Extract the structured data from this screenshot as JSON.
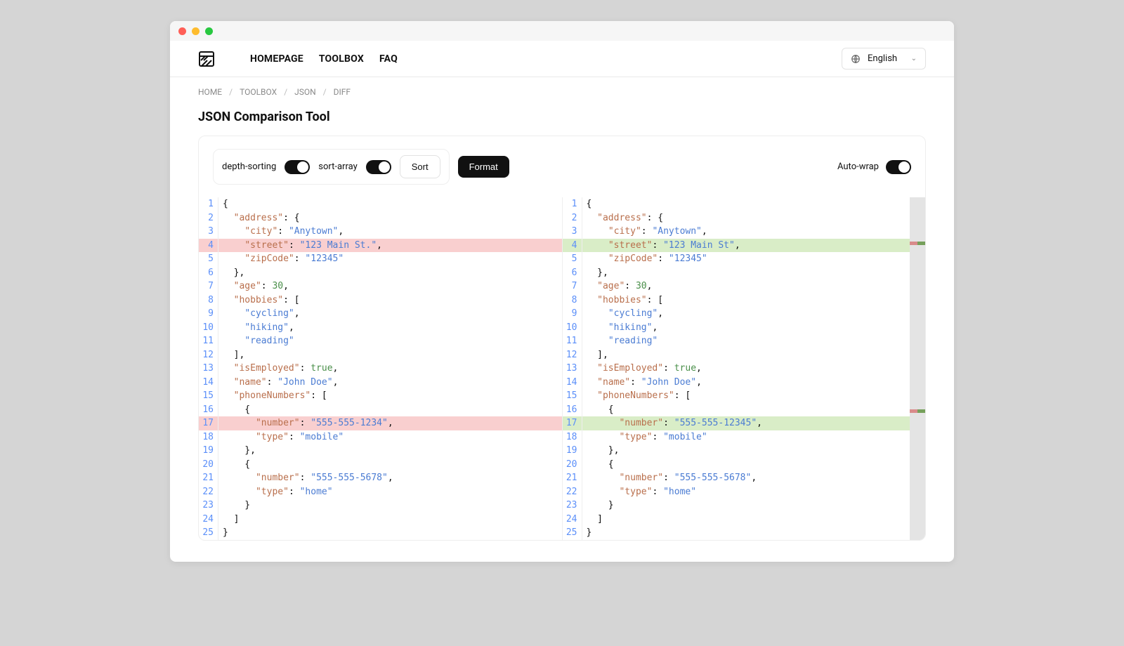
{
  "nav": {
    "home": "HOMEPAGE",
    "toolbox": "TOOLBOX",
    "faq": "FAQ"
  },
  "lang": {
    "label": "English"
  },
  "crumbs": {
    "home": "HOME",
    "toolbox": "TOOLBOX",
    "json": "JSON",
    "diff": "DIFF"
  },
  "title": "JSON Comparison Tool",
  "toolbar": {
    "depth": "depth-sorting",
    "sortarray": "sort-array",
    "sort": "Sort",
    "format": "Format",
    "autowrap": "Auto-wrap"
  },
  "leftLines": [
    [
      [
        "p",
        "{"
      ]
    ],
    [
      [
        "p",
        "  "
      ],
      [
        "k",
        "\"address\""
      ],
      [
        "p",
        ": {"
      ]
    ],
    [
      [
        "p",
        "    "
      ],
      [
        "k",
        "\"city\""
      ],
      [
        "p",
        ": "
      ],
      [
        "s",
        "\"Anytown\""
      ],
      [
        "p",
        ","
      ]
    ],
    [
      [
        "p",
        "    "
      ],
      [
        "k",
        "\"street\""
      ],
      [
        "p",
        ": "
      ],
      [
        "s",
        "\"123 Main St.\""
      ],
      [
        "p",
        ","
      ]
    ],
    [
      [
        "p",
        "    "
      ],
      [
        "k",
        "\"zipCode\""
      ],
      [
        "p",
        ": "
      ],
      [
        "s",
        "\"12345\""
      ]
    ],
    [
      [
        "p",
        "  },"
      ]
    ],
    [
      [
        "p",
        "  "
      ],
      [
        "k",
        "\"age\""
      ],
      [
        "p",
        ": "
      ],
      [
        "n",
        "30"
      ],
      [
        "p",
        ","
      ]
    ],
    [
      [
        "p",
        "  "
      ],
      [
        "k",
        "\"hobbies\""
      ],
      [
        "p",
        ": ["
      ]
    ],
    [
      [
        "p",
        "    "
      ],
      [
        "s",
        "\"cycling\""
      ],
      [
        "p",
        ","
      ]
    ],
    [
      [
        "p",
        "    "
      ],
      [
        "s",
        "\"hiking\""
      ],
      [
        "p",
        ","
      ]
    ],
    [
      [
        "p",
        "    "
      ],
      [
        "s",
        "\"reading\""
      ]
    ],
    [
      [
        "p",
        "  ],"
      ]
    ],
    [
      [
        "p",
        "  "
      ],
      [
        "k",
        "\"isEmployed\""
      ],
      [
        "p",
        ": "
      ],
      [
        "b",
        "true"
      ],
      [
        "p",
        ","
      ]
    ],
    [
      [
        "p",
        "  "
      ],
      [
        "k",
        "\"name\""
      ],
      [
        "p",
        ": "
      ],
      [
        "s",
        "\"John Doe\""
      ],
      [
        "p",
        ","
      ]
    ],
    [
      [
        "p",
        "  "
      ],
      [
        "k",
        "\"phoneNumbers\""
      ],
      [
        "p",
        ": ["
      ]
    ],
    [
      [
        "p",
        "    {"
      ]
    ],
    [
      [
        "p",
        "      "
      ],
      [
        "k",
        "\"number\""
      ],
      [
        "p",
        ": "
      ],
      [
        "s",
        "\"555-555-1234\""
      ],
      [
        "p",
        ","
      ]
    ],
    [
      [
        "p",
        "      "
      ],
      [
        "k",
        "\"type\""
      ],
      [
        "p",
        ": "
      ],
      [
        "s",
        "\"mobile\""
      ]
    ],
    [
      [
        "p",
        "    },"
      ]
    ],
    [
      [
        "p",
        "    {"
      ]
    ],
    [
      [
        "p",
        "      "
      ],
      [
        "k",
        "\"number\""
      ],
      [
        "p",
        ": "
      ],
      [
        "s",
        "\"555-555-5678\""
      ],
      [
        "p",
        ","
      ]
    ],
    [
      [
        "p",
        "      "
      ],
      [
        "k",
        "\"type\""
      ],
      [
        "p",
        ": "
      ],
      [
        "s",
        "\"home\""
      ]
    ],
    [
      [
        "p",
        "    }"
      ]
    ],
    [
      [
        "p",
        "  ]"
      ]
    ],
    [
      [
        "p",
        "}"
      ]
    ]
  ],
  "rightLines": [
    [
      [
        "p",
        "{"
      ]
    ],
    [
      [
        "p",
        "  "
      ],
      [
        "k",
        "\"address\""
      ],
      [
        "p",
        ": {"
      ]
    ],
    [
      [
        "p",
        "    "
      ],
      [
        "k",
        "\"city\""
      ],
      [
        "p",
        ": "
      ],
      [
        "s",
        "\"Anytown\""
      ],
      [
        "p",
        ","
      ]
    ],
    [
      [
        "p",
        "    "
      ],
      [
        "k",
        "\"street\""
      ],
      [
        "p",
        ": "
      ],
      [
        "s",
        "\"123 Main St\""
      ],
      [
        "p",
        ","
      ]
    ],
    [
      [
        "p",
        "    "
      ],
      [
        "k",
        "\"zipCode\""
      ],
      [
        "p",
        ": "
      ],
      [
        "s",
        "\"12345\""
      ]
    ],
    [
      [
        "p",
        "  },"
      ]
    ],
    [
      [
        "p",
        "  "
      ],
      [
        "k",
        "\"age\""
      ],
      [
        "p",
        ": "
      ],
      [
        "n",
        "30"
      ],
      [
        "p",
        ","
      ]
    ],
    [
      [
        "p",
        "  "
      ],
      [
        "k",
        "\"hobbies\""
      ],
      [
        "p",
        ": ["
      ]
    ],
    [
      [
        "p",
        "    "
      ],
      [
        "s",
        "\"cycling\""
      ],
      [
        "p",
        ","
      ]
    ],
    [
      [
        "p",
        "    "
      ],
      [
        "s",
        "\"hiking\""
      ],
      [
        "p",
        ","
      ]
    ],
    [
      [
        "p",
        "    "
      ],
      [
        "s",
        "\"reading\""
      ]
    ],
    [
      [
        "p",
        "  ],"
      ]
    ],
    [
      [
        "p",
        "  "
      ],
      [
        "k",
        "\"isEmployed\""
      ],
      [
        "p",
        ": "
      ],
      [
        "b",
        "true"
      ],
      [
        "p",
        ","
      ]
    ],
    [
      [
        "p",
        "  "
      ],
      [
        "k",
        "\"name\""
      ],
      [
        "p",
        ": "
      ],
      [
        "s",
        "\"John Doe\""
      ],
      [
        "p",
        ","
      ]
    ],
    [
      [
        "p",
        "  "
      ],
      [
        "k",
        "\"phoneNumbers\""
      ],
      [
        "p",
        ": ["
      ]
    ],
    [
      [
        "p",
        "    {"
      ]
    ],
    [
      [
        "p",
        "      "
      ],
      [
        "k",
        "\"number\""
      ],
      [
        "p",
        ": "
      ],
      [
        "s",
        "\"555-555-12345\""
      ],
      [
        "p",
        ","
      ]
    ],
    [
      [
        "p",
        "      "
      ],
      [
        "k",
        "\"type\""
      ],
      [
        "p",
        ": "
      ],
      [
        "s",
        "\"mobile\""
      ]
    ],
    [
      [
        "p",
        "    },"
      ]
    ],
    [
      [
        "p",
        "    {"
      ]
    ],
    [
      [
        "p",
        "      "
      ],
      [
        "k",
        "\"number\""
      ],
      [
        "p",
        ": "
      ],
      [
        "s",
        "\"555-555-5678\""
      ],
      [
        "p",
        ","
      ]
    ],
    [
      [
        "p",
        "      "
      ],
      [
        "k",
        "\"type\""
      ],
      [
        "p",
        ": "
      ],
      [
        "s",
        "\"home\""
      ]
    ],
    [
      [
        "p",
        "    }"
      ]
    ],
    [
      [
        "p",
        "  ]"
      ]
    ],
    [
      [
        "p",
        "}"
      ]
    ]
  ],
  "leftHighlights": {
    "4": "hl-red",
    "17": "hl-red"
  },
  "rightHighlights": {
    "4": "hl-green",
    "17": "hl-green"
  },
  "minimapMarks": [
    13,
    62
  ]
}
